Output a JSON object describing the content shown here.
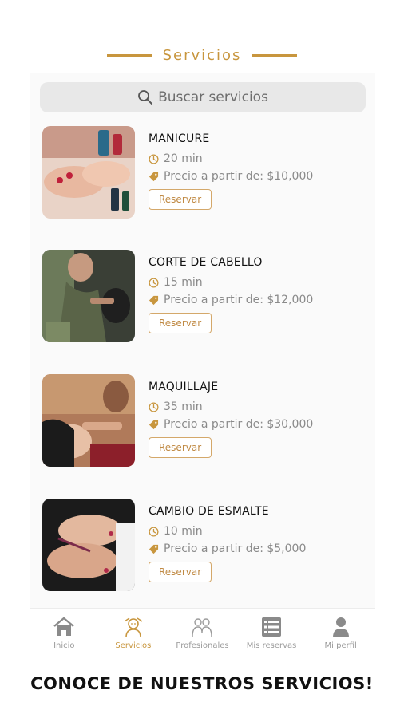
{
  "header": {
    "title": "Servicios"
  },
  "search": {
    "placeholder": "Buscar servicios"
  },
  "services": [
    {
      "name": "MANICURE",
      "duration": "20 min",
      "price": "Precio a partir de: $10,000",
      "action": "Reservar"
    },
    {
      "name": "CORTE DE CABELLO",
      "duration": "15 min",
      "price": "Precio a partir de: $12,000",
      "action": "Reservar"
    },
    {
      "name": "MAQUILLAJE",
      "duration": "35 min",
      "price": "Precio a partir de: $30,000",
      "action": "Reservar"
    },
    {
      "name": "CAMBIO DE ESMALTE",
      "duration": "10 min",
      "price": "Precio a partir de: $5,000",
      "action": "Reservar"
    }
  ],
  "tabbar": {
    "items": [
      {
        "label": "Inicio",
        "icon": "home-icon"
      },
      {
        "label": "Servicios",
        "icon": "services-icon",
        "active": true
      },
      {
        "label": "Profesionales",
        "icon": "professionals-icon"
      },
      {
        "label": "Mis reservas",
        "icon": "reservations-icon"
      },
      {
        "label": "Mi perfil",
        "icon": "profile-icon"
      }
    ]
  },
  "caption": "CONOCE DE NUESTROS SERVICIOS!",
  "colors": {
    "accent": "#c8963e",
    "button_border": "#d4a86a",
    "muted_text": "#8a8a8a"
  }
}
